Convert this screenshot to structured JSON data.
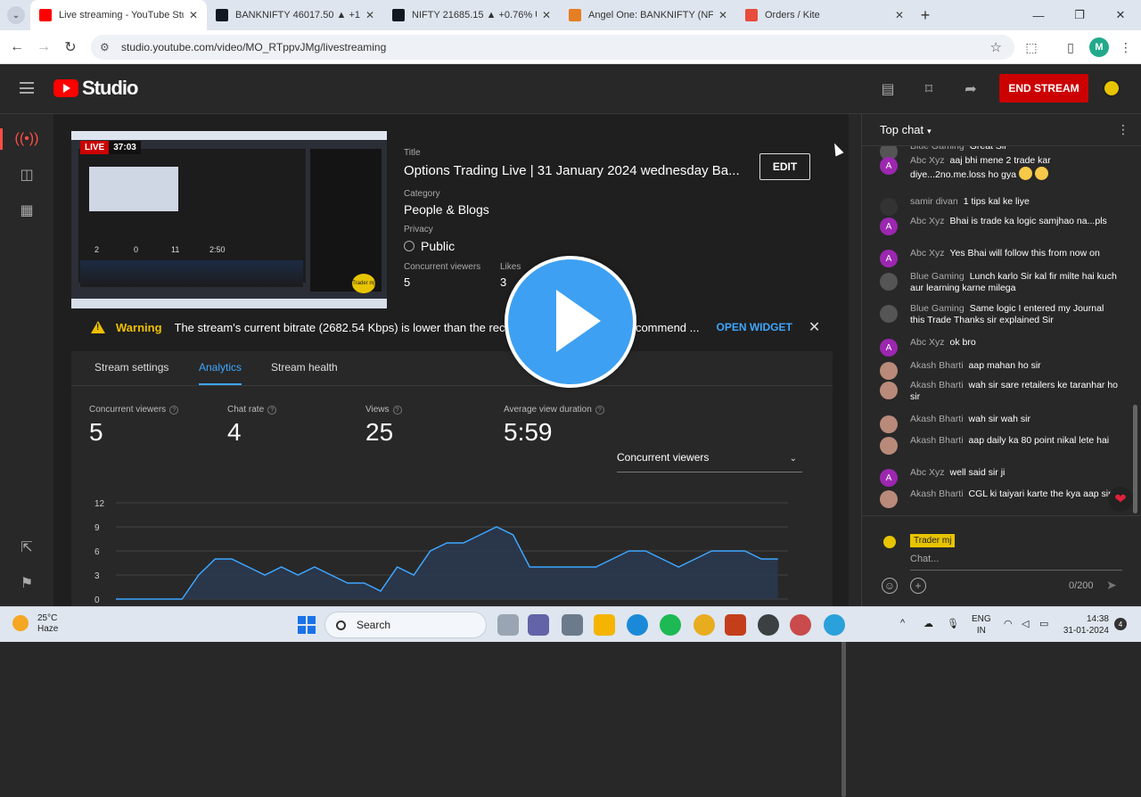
{
  "browser": {
    "tabs": [
      {
        "title": "Live streaming - YouTube Studi",
        "favicon": "youtube-icon",
        "color": "#ff0000"
      },
      {
        "title": "BANKNIFTY 46017.50 ▲ +1.43%",
        "favicon": "tradingview-icon",
        "color": "#131722"
      },
      {
        "title": "NIFTY 21685.15 ▲ +0.76% Unn",
        "favicon": "tradingview-icon",
        "color": "#131722"
      },
      {
        "title": "Angel One: BANKNIFTY (NFO)",
        "favicon": "angelone-icon",
        "color": "#e67e22"
      },
      {
        "title": "Orders / Kite",
        "favicon": "kite-icon",
        "color": "#e74c3c"
      }
    ],
    "url": "studio.youtube.com/video/MO_RTppvJMg/livestreaming",
    "profile_initial": "M"
  },
  "header": {
    "brand": "Studio",
    "end_stream_label": "END STREAM"
  },
  "stream": {
    "live_label": "LIVE",
    "elapsed": "37:03",
    "title_label": "Title",
    "title": "Options Trading Live | 31 January 2024 wednesday Ba...",
    "edit_label": "EDIT",
    "category_label": "Category",
    "category": "People & Blogs",
    "privacy_label": "Privacy",
    "privacy": "Public",
    "concurrent_label": "Concurrent viewers",
    "concurrent": "5",
    "likes_label": "Likes",
    "likes": "3",
    "preview": {
      "stats": [
        "2",
        "0",
        "11",
        "2:50"
      ],
      "badge": "Trader mj"
    }
  },
  "warning": {
    "title": "Warning",
    "text": "The stream's current bitrate (2682.54 Kbps) is lower than the recommended bitrate. We recommend ...",
    "action": "OPEN WIDGET"
  },
  "tabs_panel": {
    "tabs": [
      "Stream settings",
      "Analytics",
      "Stream health"
    ],
    "active": "Analytics"
  },
  "stats": [
    {
      "label": "Concurrent viewers",
      "value": "5"
    },
    {
      "label": "Chat rate",
      "value": "4"
    },
    {
      "label": "Views",
      "value": "25"
    },
    {
      "label": "Average view duration",
      "value": "5:59"
    }
  ],
  "metric_select": "Concurrent viewers",
  "chart_data": {
    "type": "area",
    "yticks": [
      "12",
      "9",
      "6",
      "3",
      "0"
    ],
    "ylim": [
      0,
      12
    ],
    "x": [
      0,
      1,
      2,
      3,
      4,
      5,
      6,
      7,
      8,
      9,
      10,
      11,
      12,
      13,
      14,
      15,
      16,
      17,
      18,
      19,
      20,
      21,
      22,
      23,
      24,
      25,
      26,
      27,
      28,
      29,
      30,
      31,
      32,
      33,
      34,
      35,
      36,
      37,
      38,
      39,
      40
    ],
    "values": [
      0,
      0,
      0,
      0,
      0,
      3,
      5,
      5,
      4,
      3,
      4,
      3,
      4,
      3,
      2,
      2,
      1,
      4,
      3,
      6,
      7,
      7,
      8,
      9,
      8,
      4,
      4,
      4,
      4,
      4,
      5,
      6,
      6,
      5,
      4,
      5,
      6,
      6,
      6,
      5,
      5
    ],
    "grid": true,
    "color": "#3ea6ff"
  },
  "chat": {
    "mode": "Top chat",
    "messages": [
      {
        "author": "Blue Gaming",
        "text": "Great Sir",
        "avatar": "wolf",
        "color": "#555"
      },
      {
        "author": "Abc Xyz",
        "text": "aaj bhi mene 2 trade kar diye...2no.me.loss ho gya",
        "avatar": "A",
        "color": "#9c27b0",
        "emoji": true
      },
      {
        "author": "samir divan",
        "text": "1 tips kal ke liye",
        "avatar": "logo",
        "color": "#333"
      },
      {
        "author": "Abc Xyz",
        "text": "Bhai is trade ka logic samjhao na...pls",
        "avatar": "A",
        "color": "#9c27b0"
      },
      {
        "author": "Abc Xyz",
        "text": "Yes Bhai will follow this from now on",
        "avatar": "A",
        "color": "#9c27b0"
      },
      {
        "author": "Blue Gaming",
        "text": "Lunch karlo Sir kal fir milte hai kuch aur learning karne milega",
        "avatar": "wolf",
        "color": "#555"
      },
      {
        "author": "Blue Gaming",
        "text": "Same logic I entered my Journal this Trade Thanks sir explained Sir",
        "avatar": "wolf",
        "color": "#555"
      },
      {
        "author": "Abc Xyz",
        "text": "ok bro",
        "avatar": "A",
        "color": "#9c27b0"
      },
      {
        "author": "Akash Bharti",
        "text": "aap mahan ho sir",
        "avatar": "photo",
        "color": "#b98a7a"
      },
      {
        "author": "Akash Bharti",
        "text": "wah sir sare retailers ke taranhar ho sir",
        "avatar": "photo",
        "color": "#b98a7a"
      },
      {
        "author": "Akash Bharti",
        "text": "wah sir wah sir",
        "avatar": "photo",
        "color": "#b98a7a"
      },
      {
        "author": "Akash Bharti",
        "text": "aap daily ka 80 point nikal lete hai",
        "avatar": "photo",
        "color": "#b98a7a"
      },
      {
        "author": "Abc Xyz",
        "text": "well said sir ji",
        "avatar": "A",
        "color": "#9c27b0"
      },
      {
        "author": "Akash Bharti",
        "text": "CGL ki taiyari karte the kya aap sir",
        "avatar": "photo",
        "color": "#b98a7a"
      }
    ],
    "input": {
      "channel": "Trader mj",
      "placeholder": "Chat...",
      "count": "0/200"
    }
  },
  "taskbar": {
    "weather_temp": "25°C",
    "weather_desc": "Haze",
    "search": "Search",
    "lang1": "ENG",
    "lang2": "IN",
    "time": "14:38",
    "date": "31-01-2024",
    "notif_count": "4"
  }
}
